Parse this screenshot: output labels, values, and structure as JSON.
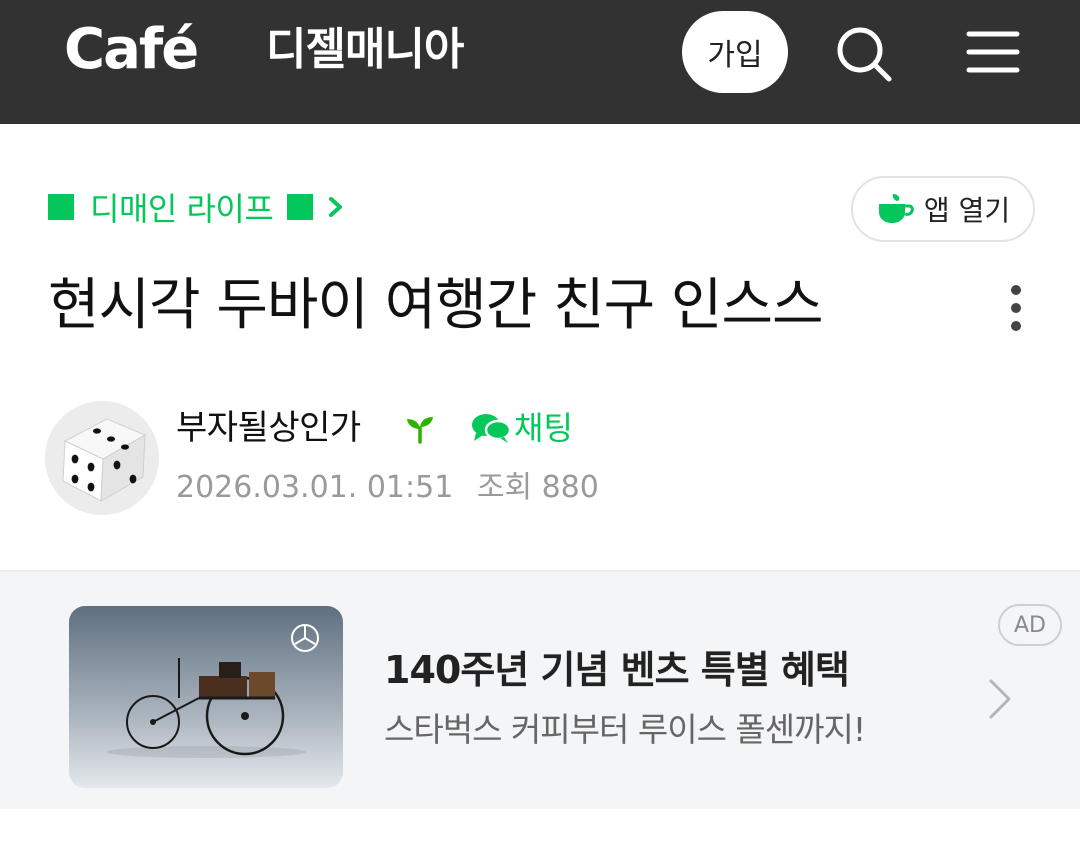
{
  "header": {
    "logo_text": "Café",
    "cafe_name": "디젤매니아",
    "join_label": "가입",
    "background": "#323232"
  },
  "breadcrumb": {
    "board_name": "디매인 라이프",
    "accent": "#03c75a"
  },
  "app_open": {
    "label": "앱 열기"
  },
  "post": {
    "title": "현시각 두바이 여행간 친구 인스스",
    "author": "부자될상인가",
    "chat_label": "채팅",
    "datetime": "2026.03.01. 01:51",
    "views": "조회 880"
  },
  "ad": {
    "title": "140주년 기념 벤츠 특별 혜택",
    "description": "스타벅스 커피부터 루이스 폴센까지!",
    "badge": "AD"
  },
  "icons": [
    "search-icon",
    "menu-icon",
    "chevron-right-icon",
    "cup-icon",
    "more-vertical-icon",
    "dice-avatar",
    "sprout-icon",
    "chat-icon"
  ]
}
